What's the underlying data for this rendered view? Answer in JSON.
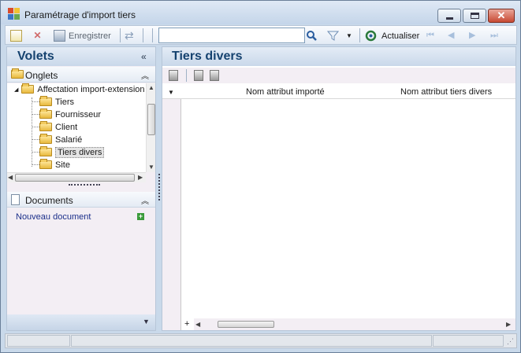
{
  "window": {
    "title": "Paramétrage d'import tiers"
  },
  "toolbar": {
    "save_label": "Enregistrer",
    "search": {
      "value": "",
      "placeholder": ""
    },
    "refresh_label": "Actualiser"
  },
  "left_panel": {
    "title": "Volets",
    "onglets": {
      "label": "Onglets",
      "tree": {
        "root": "Affectation import-extension",
        "children": [
          "Tiers",
          "Fournisseur",
          "Client",
          "Salarié",
          "Tiers divers",
          "Site"
        ],
        "selected": "Tiers divers"
      }
    },
    "documents": {
      "label": "Documents",
      "new_link": "Nouveau document"
    }
  },
  "main": {
    "title": "Tiers divers",
    "grid": {
      "columns": [
        "Nom attribut importé",
        "Nom attribut tiers divers"
      ],
      "rows": []
    }
  },
  "icons": {
    "app": "app-icon",
    "new": "new-icon",
    "delete": "delete-icon",
    "save": "save-icon",
    "sync": "sync-icon",
    "search": "search-icon",
    "filter": "filter-icon",
    "refresh": "refresh-icon",
    "first": "first-icon",
    "prev": "prev-icon",
    "next": "next-icon",
    "last": "last-icon"
  },
  "colors": {
    "title_blue": "#15426f",
    "link_blue": "#1b2f8a",
    "close_red": "#c84a33"
  }
}
